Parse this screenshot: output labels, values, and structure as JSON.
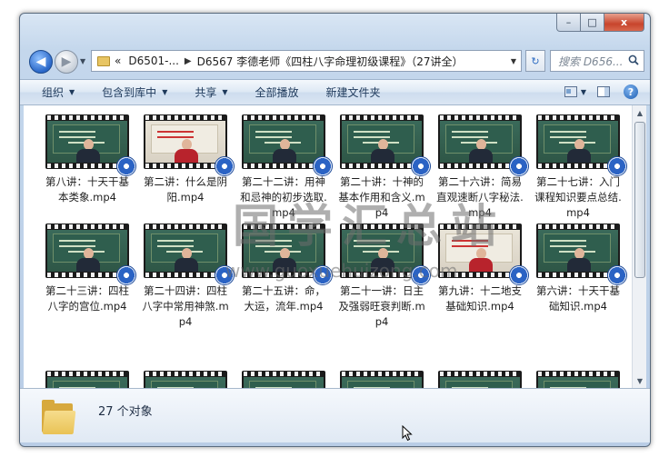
{
  "window": {
    "caption_buttons": {
      "minimize": "–",
      "maximize": "□",
      "close": "x"
    }
  },
  "address_bar": {
    "overflow": "«",
    "crumbs": [
      "D6501-...",
      "D6567 李德老师《四柱八字命理初级课程》（27讲全）"
    ],
    "separator": "▶",
    "back_glyph": "◀",
    "forward_glyph": "▶",
    "search_placeholder": "搜索 D656...",
    "refresh_glyph": "↻"
  },
  "toolbar": {
    "organize": "组织",
    "include_in_library": "包含到库中",
    "share": "共享",
    "play_all": "全部播放",
    "new_folder": "新建文件夹",
    "help": "?"
  },
  "files": [
    "第八讲：十天干基本类象.mp4",
    "第二讲：什么是阴阳.mp4",
    "第二十二讲：用神和忌神的初步选取.mp4",
    "第二十讲：十神的基本作用和含义.mp4",
    "第二十六讲：简易直观速断八字秘法.mp4",
    "第二十七讲：入门课程知识要点总结.mp4",
    "第二十三讲：四柱八字的宫位.mp4",
    "第二十四讲：四柱八字中常用神煞.mp4",
    "第二十五讲：命，大运，流年.mp4",
    "第二十一讲：日主及强弱旺衰判断.mp4",
    "第九讲：十二地支基础知识.mp4",
    "第六讲：十天干基础知识.mp4",
    "",
    "",
    "",
    "",
    "",
    ""
  ],
  "watermark": {
    "title": "国学汇总站",
    "url": "www.guoxuehuizong.com"
  },
  "status": {
    "count": "27 个对象"
  },
  "colors": {
    "accent": "#2a67c8",
    "folder": "#e9c255",
    "reel": "#2b63c4"
  },
  "icons": {
    "folder": "folder-icon",
    "video_reel": "video-reel-icon",
    "search": "search-icon",
    "help": "help-icon"
  }
}
